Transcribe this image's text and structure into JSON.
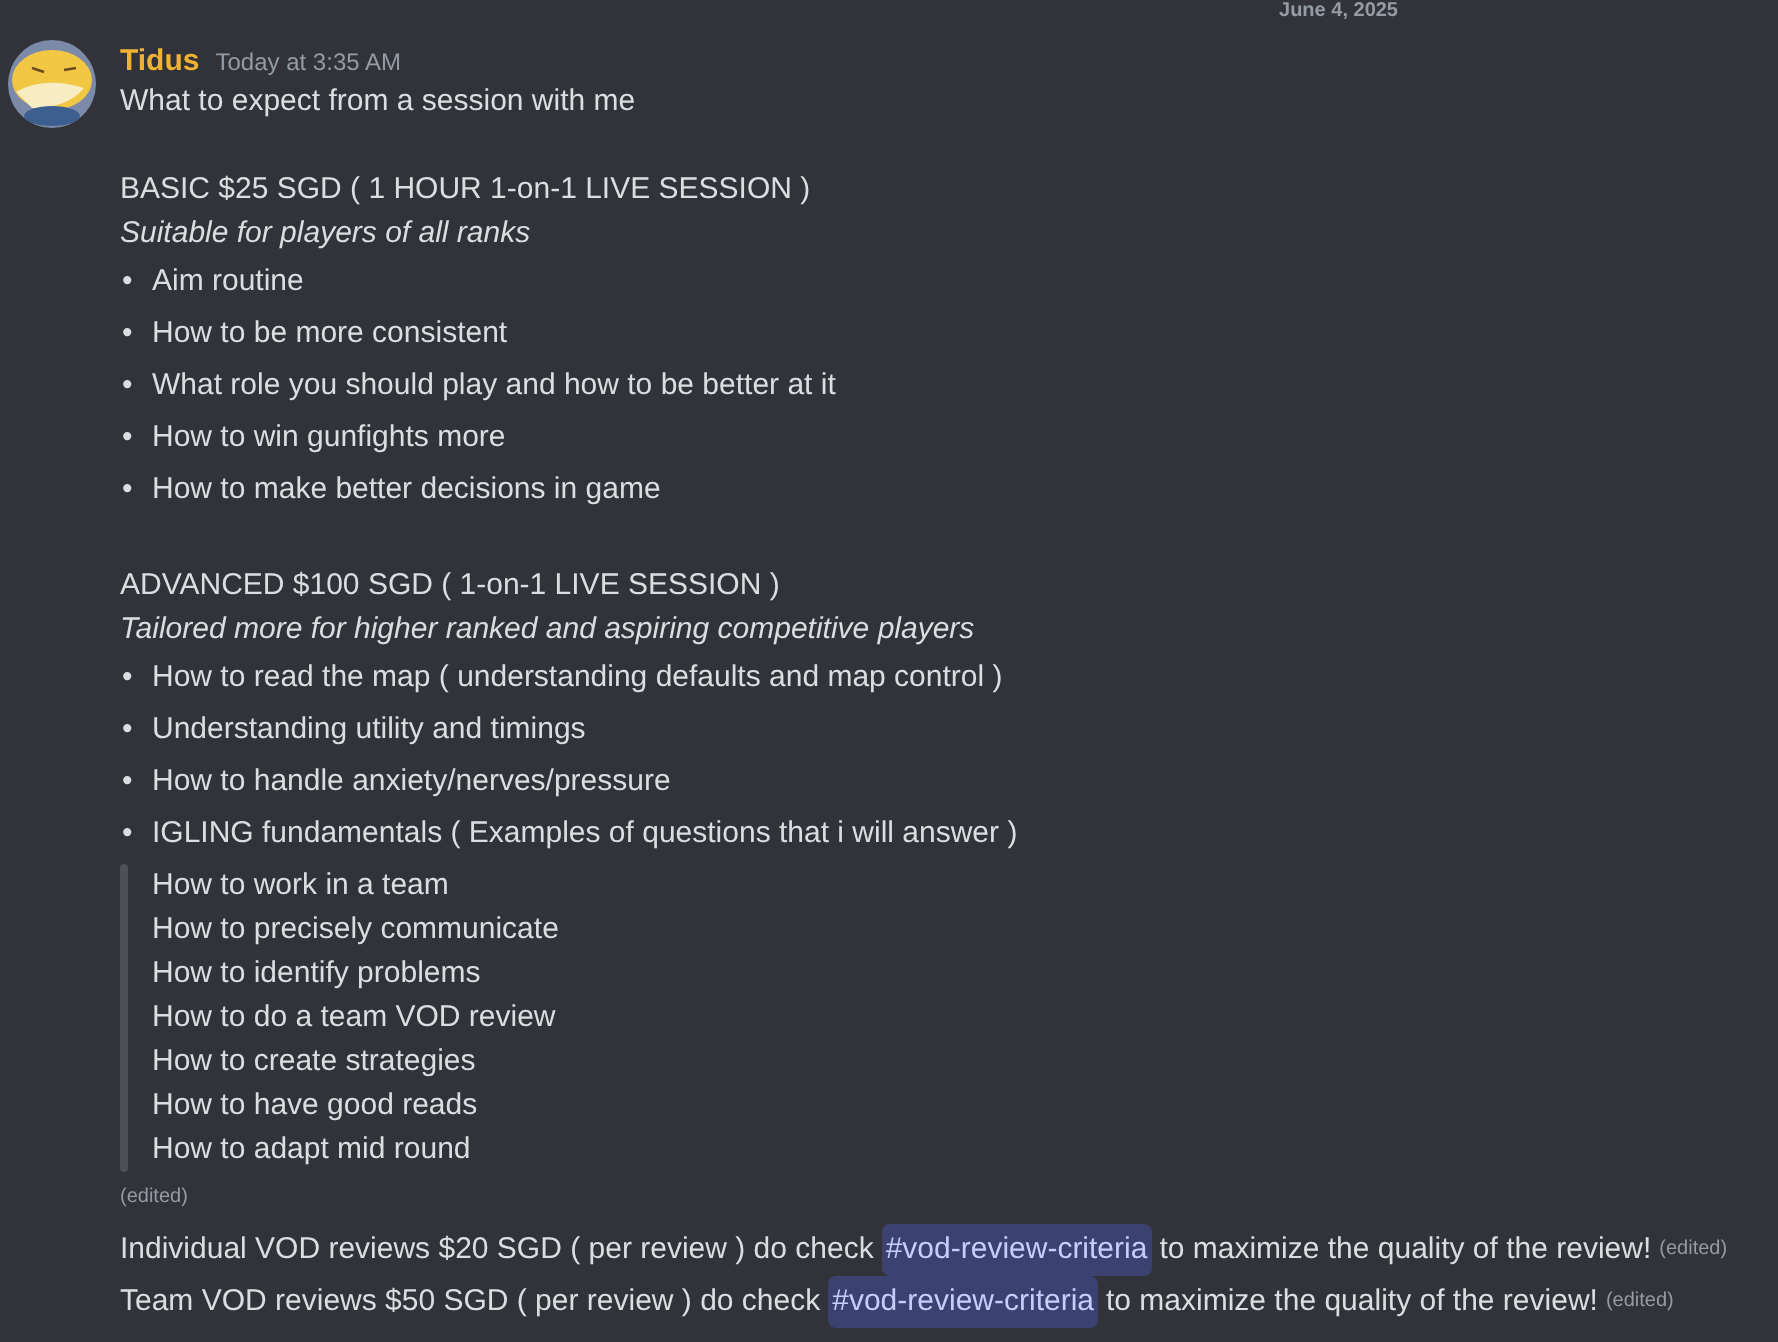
{
  "date_divider": "June 4, 2025",
  "message": {
    "author": "Tidus",
    "timestamp": "Today at 3:35 AM",
    "blocks": [
      {
        "kind": "text",
        "text": "What to expect from a session with me"
      },
      {
        "kind": "blank"
      },
      {
        "kind": "text",
        "text": "BASIC $25 SGD ( 1 HOUR 1-on-1 LIVE SESSION )"
      },
      {
        "kind": "italic",
        "text": "Suitable for players of all ranks"
      },
      {
        "kind": "bullets",
        "marker": "•",
        "items": [
          "Aim routine",
          "How to be more consistent",
          "What role you should play and how to be better at it",
          "How to win gunfights more",
          "How to make better decisions in game"
        ]
      },
      {
        "kind": "blank"
      },
      {
        "kind": "text",
        "text": "ADVANCED $100 SGD ( 1-on-1 LIVE SESSION )"
      },
      {
        "kind": "italic",
        "text": "Tailored more for higher ranked and aspiring competitive players"
      },
      {
        "kind": "bullets",
        "marker": "•",
        "items": [
          "How to read the map ( understanding defaults and map control )",
          "Understanding utility and timings",
          "How to handle anxiety/nerves/pressure",
          "IGLING fundamentals ( Examples of questions that i will answer )"
        ]
      },
      {
        "kind": "quote",
        "items": [
          "How to work in a team",
          "How to precisely communicate",
          "How to identify problems",
          "How to do a team VOD review",
          "How to create strategies",
          "How to have good reads",
          "How to adapt mid round"
        ]
      },
      {
        "kind": "edited",
        "text": "(edited)"
      }
    ]
  },
  "followups": [
    {
      "before": "Individual VOD reviews $20 SGD ( per review ) do check",
      "channel": "#vod-review-criteria",
      "after": "to maximize the quality of the review!",
      "edited": "(edited)"
    },
    {
      "before": "Team VOD reviews $50 SGD ( per review ) do check",
      "channel": "#vod-review-criteria",
      "after": "to maximize the quality of the review!",
      "edited": "(edited)"
    }
  ]
}
